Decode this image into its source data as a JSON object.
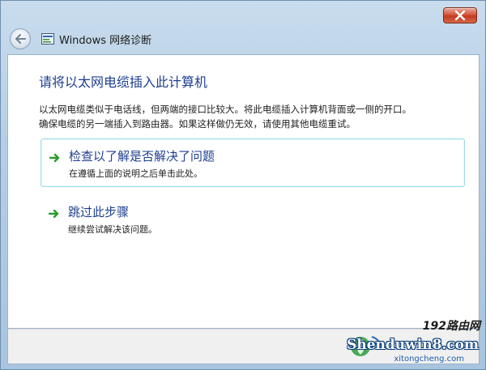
{
  "window": {
    "title": "Windows 网络诊断"
  },
  "content": {
    "heading": "请将以太网电缆插入此计算机",
    "description_lines": [
      "以太网电缆类似于电话线，但两端的接口比较大。将此电缆插入计算机背面或一侧的开口。",
      "确保电缆的另一端插入到路由器。如果这样做仍无效，请使用其他电缆重试。"
    ],
    "options": [
      {
        "title": "检查以了解是否解决了问题",
        "subtitle": "在遵循上面的说明之后单击此处。"
      },
      {
        "title": "跳过此步骤",
        "subtitle": "继续尝试解决该问题。"
      }
    ]
  },
  "watermark": {
    "brand": "192路由网",
    "main": "Shenduwin8.com",
    "sub": "xitongcheng.com"
  },
  "colors": {
    "accent": "#1e3f8f",
    "arrow": "#2e9a2e",
    "close": "#c23a1f",
    "highlight_border": "#9fdbe8"
  },
  "icons": {
    "close": "close-icon",
    "back": "back-arrow-icon",
    "title": "network-diagnostics-icon",
    "option_arrow": "green-arrow-icon"
  }
}
